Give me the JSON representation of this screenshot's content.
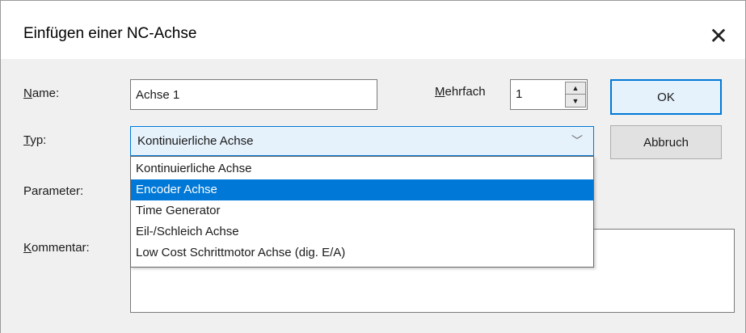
{
  "dialog": {
    "title": "Einfügen einer NC-Achse",
    "close_glyph": "✕"
  },
  "form": {
    "name_label_accel": "N",
    "name_label_rest": "ame:",
    "name_value": "Achse 1",
    "mehrfach_label_accel": "M",
    "mehrfach_label_rest": "ehrfach",
    "mehrfach_value": "1",
    "typ_label_accel": "T",
    "typ_label_rest": "yp:",
    "typ_value": "Kontinuierliche Achse",
    "parameter_label": "Parameter:",
    "kommentar_label_accel": "K",
    "kommentar_label_rest": "ommentar:",
    "kommentar_value": ""
  },
  "buttons": {
    "ok": "OK",
    "cancel": "Abbruch"
  },
  "dropdown": {
    "items": [
      "Kontinuierliche Achse",
      "Encoder Achse",
      "Time Generator",
      "Eil-/Schleich Achse",
      "Low Cost Schrittmotor Achse (dig. E/A)"
    ],
    "highlighted": "Encoder Achse"
  },
  "icons": {
    "close": "close-icon",
    "spin_up": "spin-up-arrow-icon",
    "spin_down": "spin-down-arrow-icon",
    "combo_chevron": "chevron-down-icon"
  },
  "colors": {
    "accent": "#0078d7",
    "selection_text": "#ffffff",
    "dialog_bg": "#f0f0f0",
    "combo_focus_bg": "#e5f1fb"
  }
}
